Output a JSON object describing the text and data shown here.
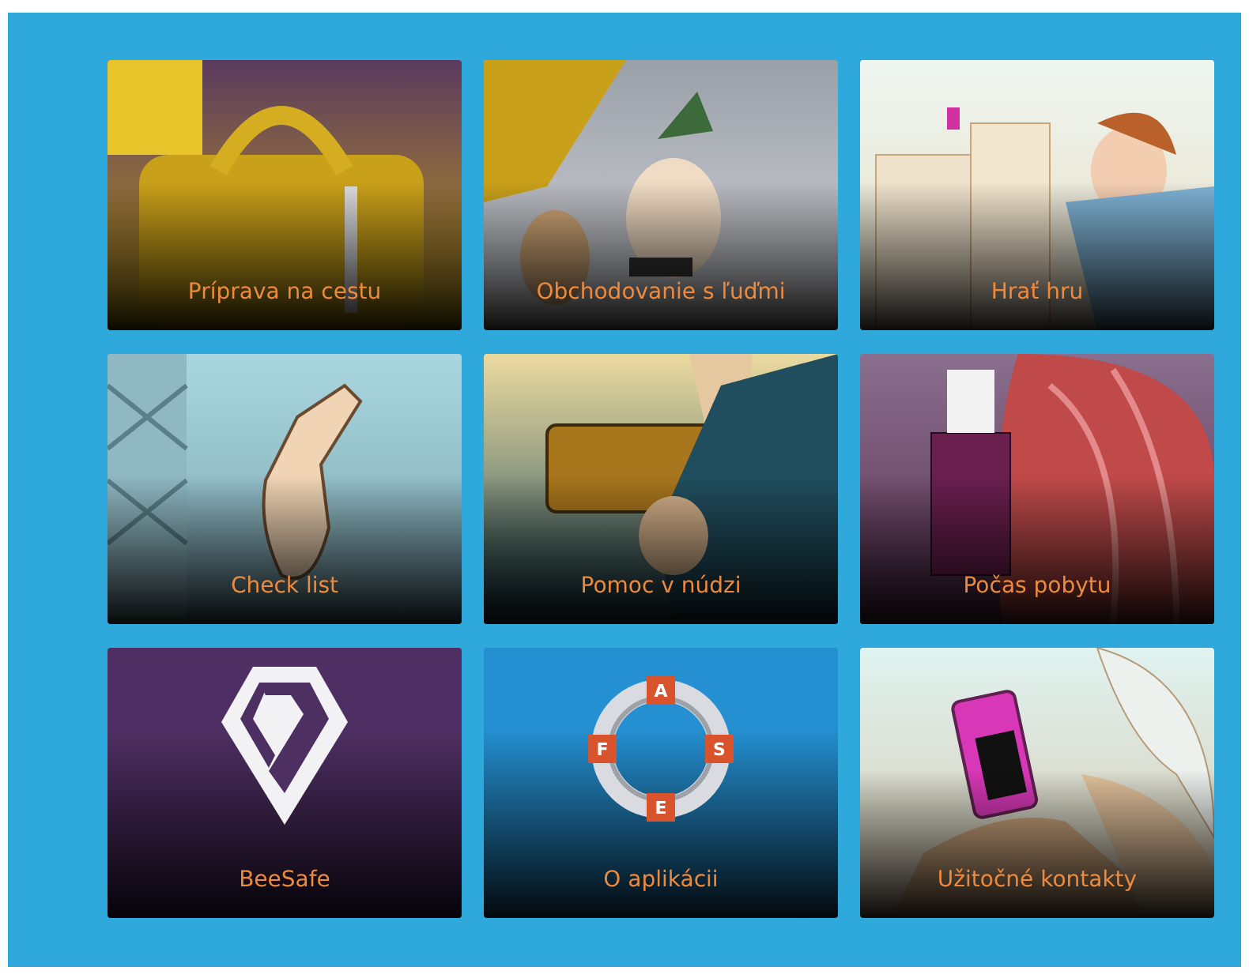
{
  "tiles": [
    {
      "label": "Príprava na cestu",
      "kind": "picture"
    },
    {
      "label": "Obchodovanie s ľuďmi",
      "kind": "picture"
    },
    {
      "label": "Hrať hru",
      "kind": "picture"
    },
    {
      "label": "Check list",
      "kind": "picture"
    },
    {
      "label": "Pomoc v núdzi",
      "kind": "picture"
    },
    {
      "label": "Počas pobytu",
      "kind": "picture"
    },
    {
      "label": "BeeSafe",
      "kind": "logo"
    },
    {
      "label": "O aplikácii",
      "kind": "lifebuoy"
    },
    {
      "label": "Užitočné kontakty",
      "kind": "picture"
    }
  ],
  "lifebuoy_letters": [
    "A",
    "S",
    "E",
    "F"
  ]
}
